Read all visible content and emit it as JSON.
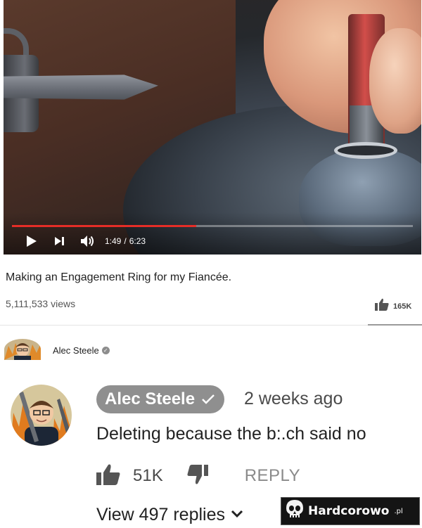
{
  "video": {
    "progress_fraction": 0.46,
    "current_time": "1:49",
    "separator": "/",
    "duration": "6:23",
    "played_color": "#e52d27",
    "icons": [
      "play-icon",
      "next-icon",
      "volume-icon"
    ]
  },
  "meta": {
    "title": "Making an Engagement Ring for my Fiancée.",
    "views": "5,111,533 views",
    "likes": "165K"
  },
  "channel": {
    "name": "Alec Steele"
  },
  "comment": {
    "author": "Alec Steele",
    "time": "2 weeks ago",
    "text": "Deleting because the b:.ch said no",
    "likes": "51K",
    "reply_label": "REPLY",
    "view_replies": "View 497 replies",
    "author_badge_color": "#8f8f8f"
  },
  "watermark": {
    "brand": "Hardcorowo",
    "suffix": ".pl"
  }
}
